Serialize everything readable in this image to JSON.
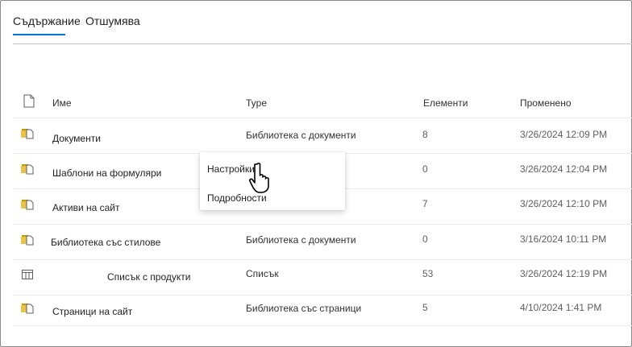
{
  "tabs": [
    {
      "label": "Съдържание",
      "selected": true
    },
    {
      "label": "Отшумява",
      "selected": false
    }
  ],
  "columns": {
    "file_type_icon": "document-icon",
    "name": "Име",
    "type": "Type",
    "items": "Елементи",
    "modified": "Променено"
  },
  "rows": [
    {
      "icon": "library-icon",
      "name": "Документи",
      "type": "Библиотека с документи",
      "items": "8",
      "modified": "3/26/2024 12:09 PM"
    },
    {
      "icon": "library-icon",
      "name": "Шаблони на формуляри",
      "type": "",
      "items": "0",
      "modified": "3/26/2024 12:04 PM"
    },
    {
      "icon": "library-icon",
      "name": "Активи на сайт",
      "type": "",
      "items": "7",
      "modified": "3/26/2024 12:10 PM"
    },
    {
      "icon": "library-icon",
      "name": "Библиотека със стилове",
      "type": "Библиотека с документи",
      "items": "0",
      "modified": "3/16/2024 10:11 PM"
    },
    {
      "icon": "list-icon",
      "name": "Списък с продукти",
      "type": "Списък",
      "items": "53",
      "modified": "3/26/2024 12:19 PM"
    },
    {
      "icon": "library-icon",
      "name": "Страници на сайт",
      "type": "Библиотека със страници",
      "items": "5",
      "modified": "4/10/2024 1:41 PM"
    }
  ],
  "context_menu": {
    "items": [
      "Настройки",
      "Подробности"
    ]
  },
  "colors": {
    "accent": "#0078d4",
    "library_icon": "#c19c00",
    "divider": "#edebe9"
  }
}
